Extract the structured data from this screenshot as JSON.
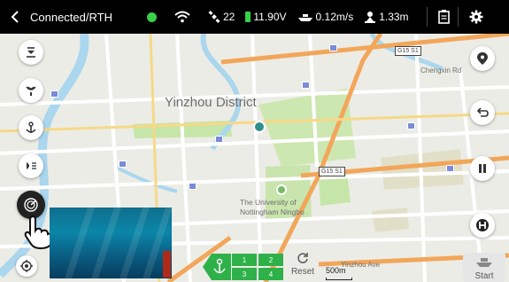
{
  "topbar": {
    "title": "Connected/RTH",
    "satellites": "22",
    "voltage": "11.90V",
    "speed": "0.12m/s",
    "distance": "1.33m"
  },
  "map": {
    "labels": {
      "district": "Yinzhou District",
      "university_1": "The University of",
      "university_2": "Nottingham Ningbo",
      "chengxin": "Chengxin Rd",
      "yinzhou_ave": "Yinzhou Ave",
      "s_label": "S",
      "vertical_1": "ḿ",
      "vertical_2": "鄞州大道"
    },
    "road_badges": {
      "r1": "G15 S1",
      "r2": "G15 S1"
    },
    "scale": "500m"
  },
  "controls": {
    "waypoints": [
      "1",
      "2",
      "3",
      "4"
    ],
    "reset": "Reset",
    "start": "Start"
  },
  "colors": {
    "status_green": "#37d046",
    "waypoint_green": "#2fb14a",
    "river_blue": "#aad6ee",
    "park_green": "#c5e6a8",
    "highway_orange": "#f2a65a"
  }
}
